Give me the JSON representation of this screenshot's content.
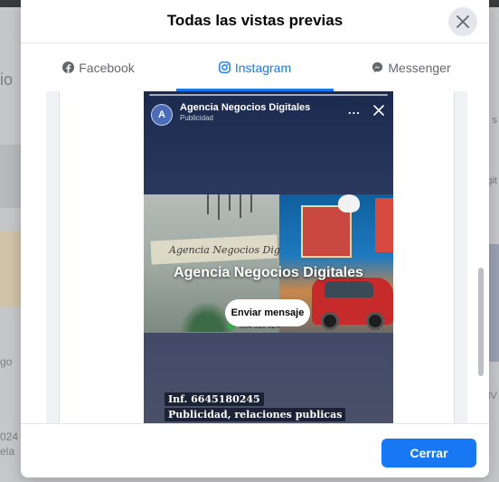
{
  "background": {
    "left_heading": "io",
    "left_lines": [
      "go",
      "024",
      "ela"
    ],
    "right_lines": [
      "s",
      "git",
      "NV"
    ]
  },
  "dialog": {
    "title": "Todas las vistas previas",
    "tabs": [
      {
        "label": "Facebook",
        "icon": "facebook-icon",
        "active": false
      },
      {
        "label": "Instagram",
        "icon": "instagram-icon",
        "active": true
      },
      {
        "label": "Messenger",
        "icon": "messenger-icon",
        "active": false
      }
    ],
    "close_label": "Cerrar",
    "accent_color": "#1877f2"
  },
  "story": {
    "avatar_letter": "A",
    "page_name": "Agencia Negocios Digitales",
    "sponsored": "Publicidad",
    "more": "...",
    "image_sign_text": "Agencia Negocios Digitales",
    "image_phone_text": "664 518 0245",
    "headline": "Agencia Negocios Digitales",
    "cta": "Enviar mensaje",
    "info_line_1": "Inf. 6645180245",
    "info_line_2": "Publicidad, relaciones publicas"
  }
}
